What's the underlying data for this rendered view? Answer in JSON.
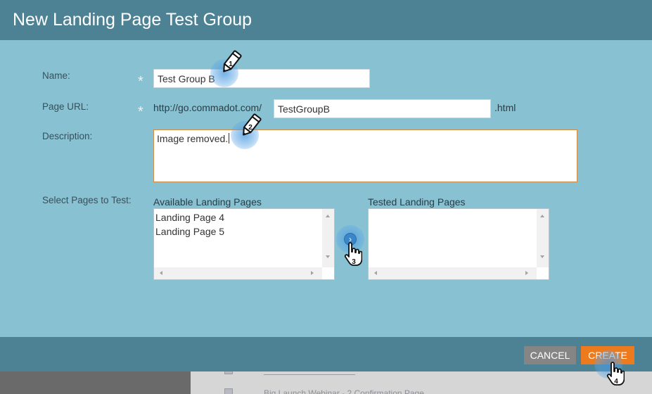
{
  "dialog": {
    "title": "New Landing Page Test Group",
    "fields": {
      "name": {
        "label": "Name:",
        "value": "Test Group B"
      },
      "page_url": {
        "label": "Page URL:",
        "prefix": "http://go.commadot.com/",
        "value": "TestGroupB",
        "suffix": ".html"
      },
      "description": {
        "label": "Description:",
        "value": "Image removed."
      },
      "pages": {
        "label": "Select Pages to Test:"
      }
    },
    "required_marker": "*",
    "available": {
      "heading": "Available Landing Pages",
      "items": [
        "Landing Page 4",
        "Landing Page 5"
      ]
    },
    "tested": {
      "heading": "Tested Landing Pages",
      "items": []
    },
    "move_glyph": "›",
    "buttons": {
      "cancel": "CANCEL",
      "create": "CREATE"
    },
    "steps": [
      "1",
      "2",
      "3",
      "4"
    ]
  },
  "background_page": {
    "rows": [
      "Big Launch Webinar - 2 Confirmation Page"
    ]
  },
  "colors": {
    "titlebar": "#4d8295",
    "body": "#87c1d2",
    "create_button": "#ee7a1e",
    "cancel_button": "#858585",
    "description_border": "#d48a42"
  }
}
